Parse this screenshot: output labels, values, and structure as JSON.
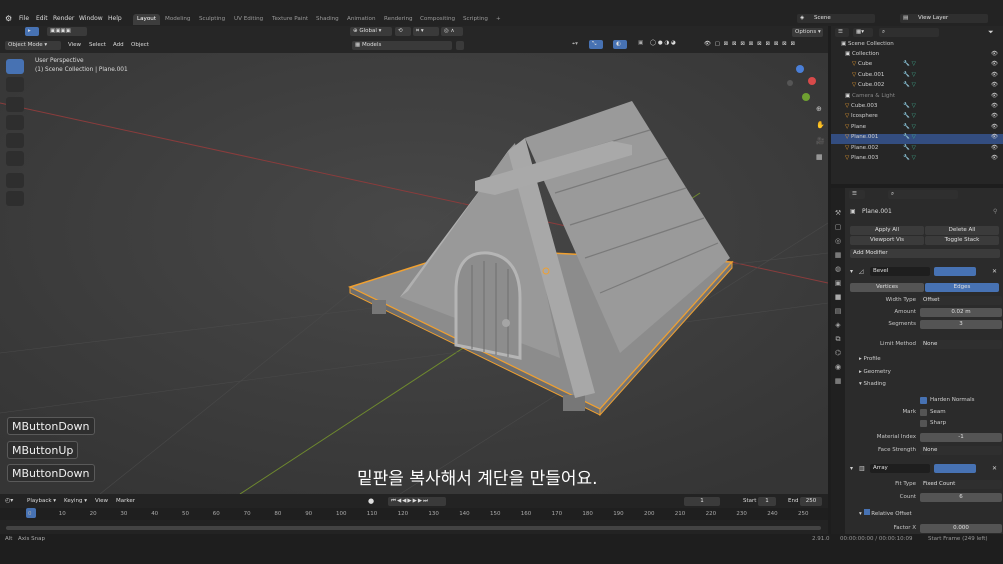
{
  "menu": {
    "file": "File",
    "edit": "Edit",
    "render": "Render",
    "window": "Window",
    "help": "Help"
  },
  "workspaces": [
    "Layout",
    "Modeling",
    "Sculpting",
    "UV Editing",
    "Texture Paint",
    "Shading",
    "Animation",
    "Rendering",
    "Compositing",
    "Scripting"
  ],
  "scene": {
    "name": "Scene",
    "view_layer": "View Layer"
  },
  "header": {
    "mode": "Object Mode",
    "view": "View",
    "select": "Select",
    "add": "Add",
    "object": "Object",
    "orientation": "Global",
    "snap_target": "Models",
    "options": "Options"
  },
  "viewport": {
    "perspective": "User Perspective",
    "collection": "(1) Scene Collection | Plane.001"
  },
  "overlay_keys": [
    "MButtonDown",
    "MButtonUp",
    "MButtonDown"
  ],
  "subtitle": "밑판을 복사해서 계단을 만들어요.",
  "outliner": {
    "root": "Scene Collection",
    "items": [
      {
        "name": "Collection",
        "level": 1
      },
      {
        "name": "Cube",
        "level": 2
      },
      {
        "name": "Cube.001",
        "level": 2
      },
      {
        "name": "Cube.002",
        "level": 2
      },
      {
        "name": "Camera & Light",
        "level": 1
      },
      {
        "name": "Cube.003",
        "level": 1
      },
      {
        "name": "Icosphere",
        "level": 1
      },
      {
        "name": "Plane",
        "level": 1
      },
      {
        "name": "Plane.001",
        "level": 1
      },
      {
        "name": "Plane.002",
        "level": 1
      },
      {
        "name": "Plane.003",
        "level": 1
      }
    ]
  },
  "properties": {
    "object": "Plane.001",
    "apply_all": "Apply All",
    "delete_all": "Delete All",
    "viewport_vis": "Viewport Vis",
    "toggle_stack": "Toggle Stack",
    "add_modifier": "Add Modifier",
    "bevel": {
      "name": "Bevel",
      "vertices": "Vertices",
      "edges": "Edges",
      "width_type_label": "Width Type",
      "width_type": "Offset",
      "amount_label": "Amount",
      "amount": "0.02 m",
      "segments_label": "Segments",
      "segments": "3",
      "limit_label": "Limit Method",
      "limit": "None",
      "profile": "Profile",
      "geometry": "Geometry",
      "shading": "Shading",
      "harden": "Harden Normals",
      "mark": "Mark",
      "seam": "Seam",
      "sharp": "Sharp",
      "material_label": "Material Index",
      "material": "-1",
      "face_label": "Face Strength",
      "face": "None"
    },
    "array": {
      "name": "Array",
      "fit_label": "Fit Type",
      "fit": "Fixed Count",
      "count_label": "Count",
      "count": "6",
      "relative": "Relative Offset",
      "factor_label": "Factor X",
      "factor": "0.000"
    }
  },
  "timeline": {
    "playback": "Playback",
    "keying": "Keying",
    "view": "View",
    "marker": "Marker",
    "current": "1",
    "start_label": "Start",
    "start": "1",
    "end_label": "End",
    "end": "250",
    "ticks": [
      "0",
      "10",
      "20",
      "30",
      "40",
      "50",
      "60",
      "70",
      "80",
      "90",
      "100",
      "110",
      "120",
      "130",
      "140",
      "150",
      "160",
      "170",
      "180",
      "190",
      "200",
      "210",
      "220",
      "230",
      "240",
      "250"
    ]
  },
  "status": {
    "snap": "Axis Snap",
    "version": "2.91.0",
    "time": "00:00:00:00 / 00:00:10:09",
    "frame": "Start Frame (249 left)"
  },
  "colors": {
    "accent": "#4772b3",
    "select": "#f0a030",
    "bg": "#3e3e3e"
  }
}
